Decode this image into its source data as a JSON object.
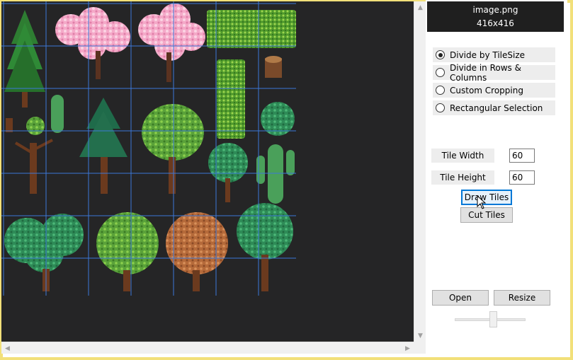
{
  "image_info": {
    "filename": "image.png",
    "dimensions": "416x416"
  },
  "modes": [
    {
      "label": "Divide by TileSize",
      "checked": true
    },
    {
      "label": "Divide in Rows & Columns",
      "checked": false
    },
    {
      "label": "Custom Cropping",
      "checked": false
    },
    {
      "label": "Rectangular Selection",
      "checked": false
    }
  ],
  "tile_width": {
    "label": "Tile Width",
    "value": "60"
  },
  "tile_height": {
    "label": "Tile Height",
    "value": "60"
  },
  "buttons": {
    "draw_tiles": "Draw Tiles",
    "cut_tiles": "Cut Tiles",
    "open": "Open",
    "resize": "Resize"
  },
  "zoom_slider": {
    "value": 0.55
  },
  "colors": {
    "canvas_bg": "#252526",
    "grid_line": "#3c78d8",
    "frame_border": "#f2e079"
  }
}
